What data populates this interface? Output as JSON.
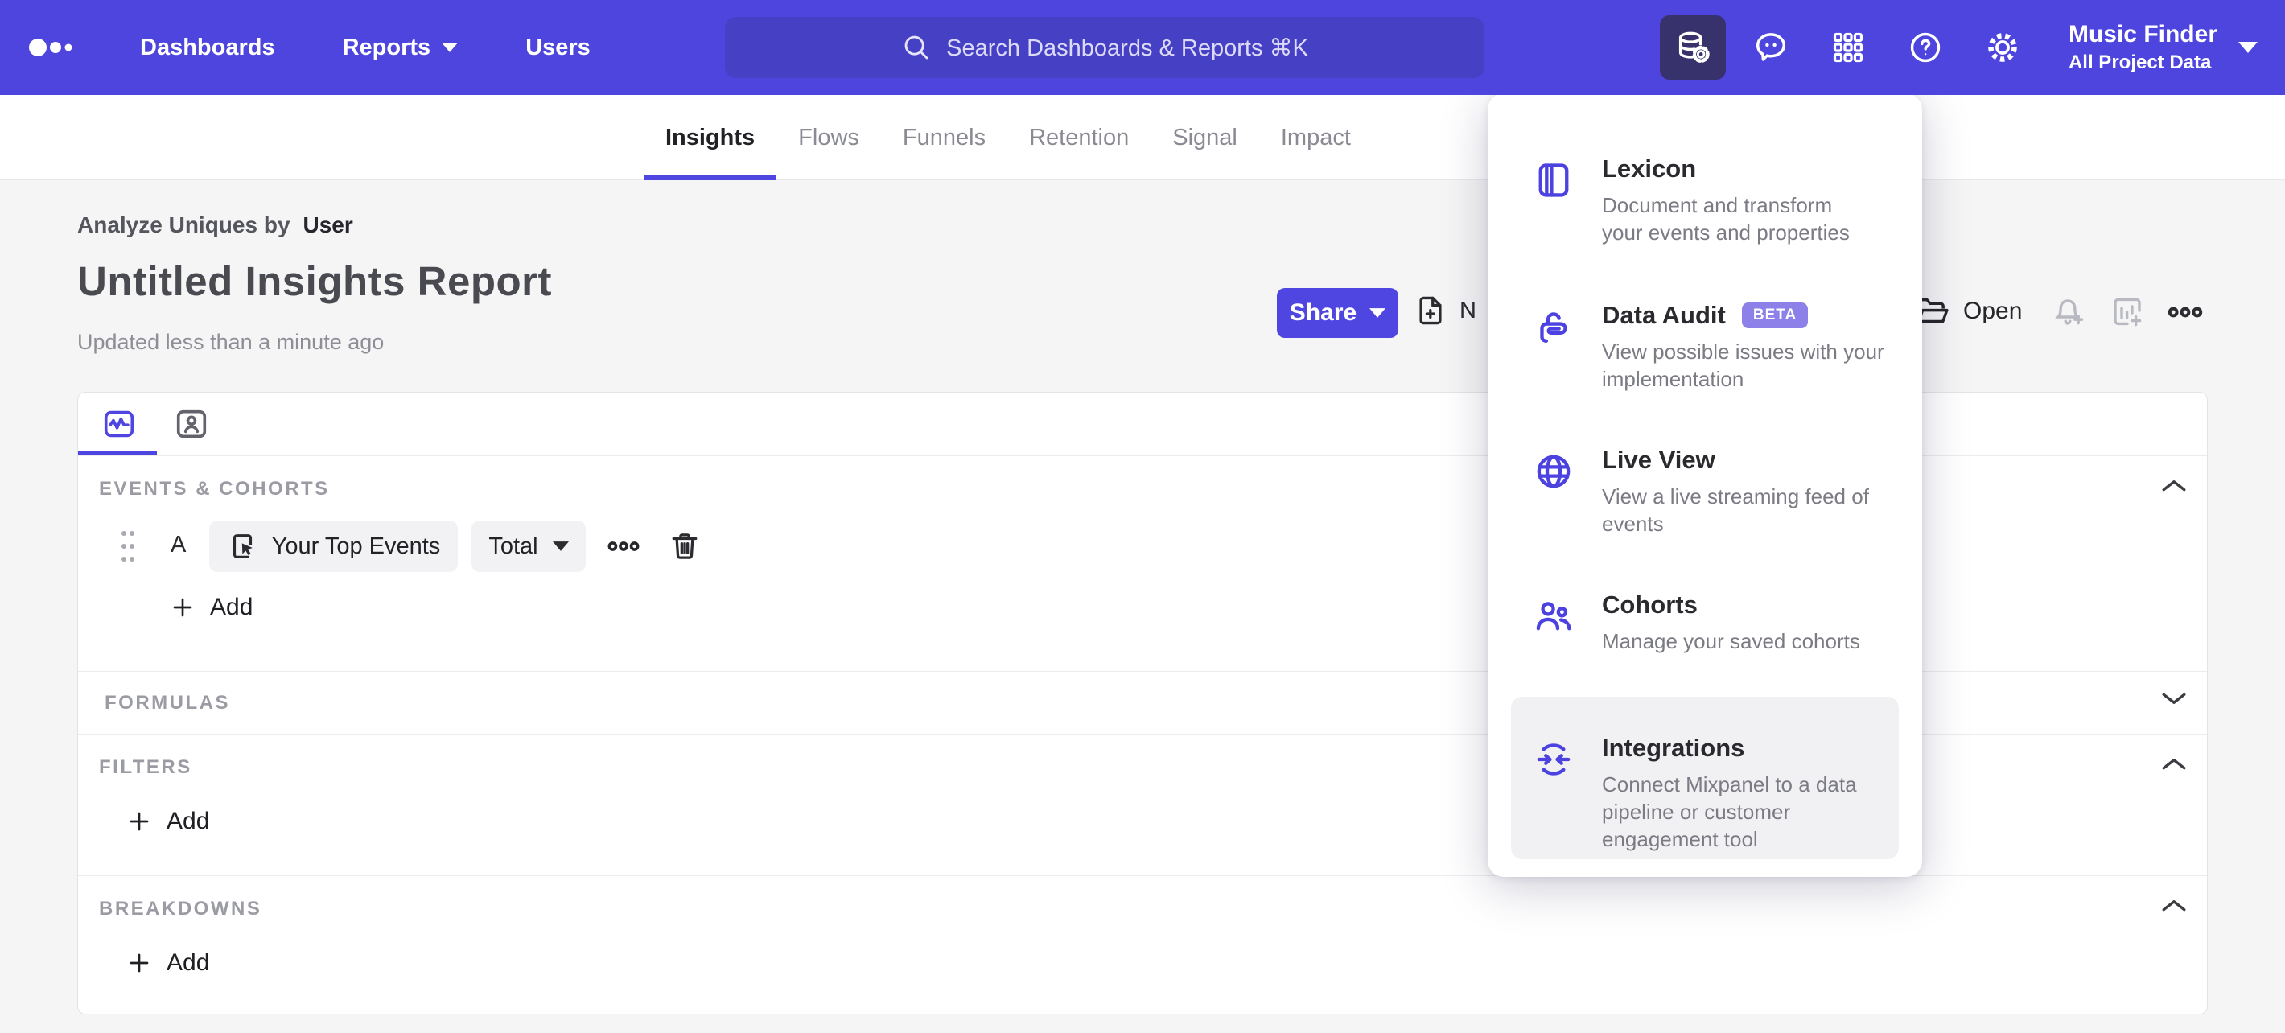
{
  "colors": {
    "accent": "#4f45e1",
    "topbar": "#4d45de",
    "search_fill": "#4640c4",
    "active_tool_bg": "#38326c",
    "beta_badge": "#8d80e8",
    "page_bg": "#f5f5f6"
  },
  "topbar": {
    "nav_items": [
      {
        "label": "Dashboards",
        "caret": false
      },
      {
        "label": "Reports",
        "caret": true
      },
      {
        "label": "Users",
        "caret": false
      }
    ],
    "search": {
      "placeholder": "Search Dashboards & Reports ⌘K"
    },
    "project": {
      "name": "Music Finder",
      "scope": "All Project Data"
    }
  },
  "subnav": {
    "tabs": [
      "Insights",
      "Flows",
      "Funnels",
      "Retention",
      "Signal",
      "Impact"
    ],
    "active_tab": "Insights"
  },
  "report": {
    "analyze_label": "Analyze Uniques by",
    "analyze_value": "User",
    "title": "Untitled Insights Report",
    "updated": "Updated less than a minute ago",
    "actions": {
      "share": "Share",
      "new_fragment": "N",
      "open": "Open"
    }
  },
  "builder": {
    "events": {
      "label": "EVENTS & COHORTS",
      "row_letter": "A",
      "event_name": "Your Top Events",
      "metric": "Total",
      "add": "Add"
    },
    "formulas": {
      "label": "FORMULAS"
    },
    "filters": {
      "label": "FILTERS",
      "add": "Add"
    },
    "breakdowns": {
      "label": "BREAKDOWNS",
      "add": "Add"
    }
  },
  "menu": {
    "items": [
      {
        "title": "Lexicon",
        "desc": "Document and transform\nyour events and properties"
      },
      {
        "title": "Data Audit",
        "badge": "BETA",
        "desc": "View possible issues with your\nimplementation"
      },
      {
        "title": "Live View",
        "desc": "View a live streaming feed of\nevents"
      },
      {
        "title": "Cohorts",
        "desc": "Manage your saved cohorts"
      },
      {
        "title": "Integrations",
        "desc": "Connect Mixpanel to a data\npipeline or customer\nengagement tool"
      }
    ]
  }
}
